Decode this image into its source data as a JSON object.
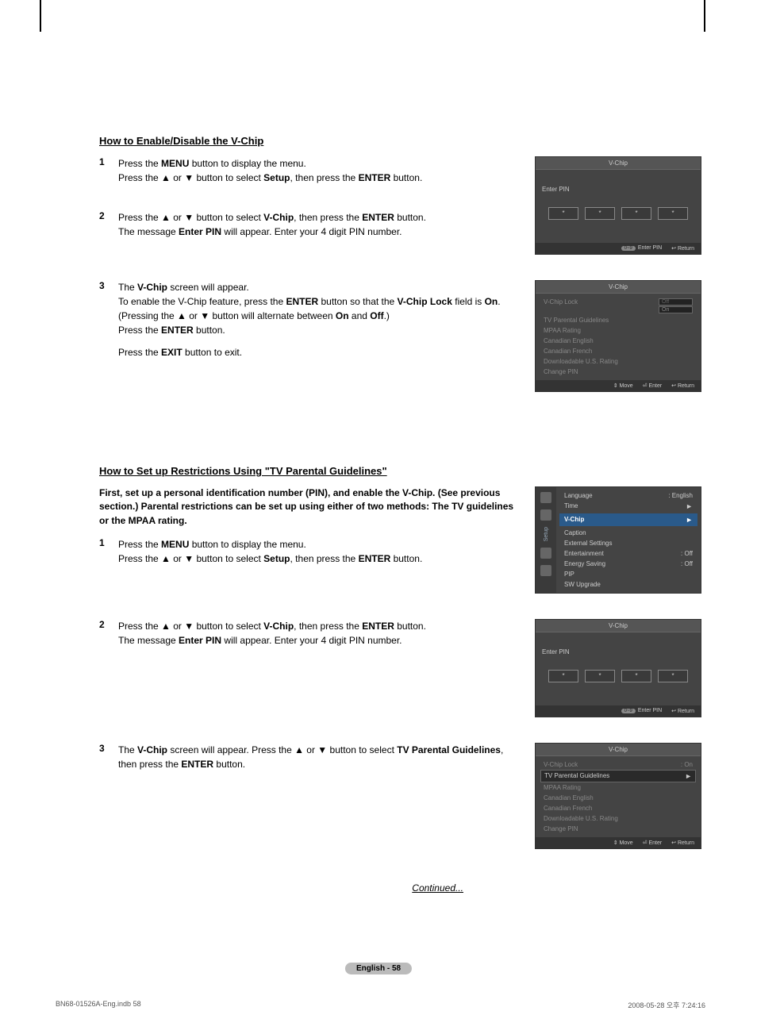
{
  "section1_title": "How to Enable/Disable the V-Chip",
  "section2_title": "How to Set up Restrictions Using \"TV Parental Guidelines\"",
  "intro": "First, set up a personal identification number (PIN), and enable the V-Chip. (See previous section.) Parental restrictions can be set up using either of two methods: The TV guidelines or the MPAA rating.",
  "s1": {
    "step1_a": "Press the ",
    "step1_b": "MENU",
    "step1_c": " button to display the menu.",
    "step1_d": "Press the ▲ or ▼ button to select ",
    "step1_e": "Setup",
    "step1_f": ", then press the ",
    "step1_g": "ENTER",
    "step1_h": " button.",
    "step2_a": "Press the ▲ or ▼ button to select ",
    "step2_b": "V-Chip",
    "step2_c": ", then press the ",
    "step2_d": "ENTER",
    "step2_e": " button.",
    "step2_f": "The message ",
    "step2_g": "Enter PIN",
    "step2_h": " will appear. Enter your 4 digit PIN number.",
    "step3_a": "The ",
    "step3_b": "V-Chip",
    "step3_c": " screen will appear.",
    "step3_d": "To enable the V-Chip feature, press the ",
    "step3_e": "ENTER",
    "step3_f": " button so that the ",
    "step3_g": "V-Chip Lock",
    "step3_h": " field is ",
    "step3_i": "On",
    "step3_j": ". (Pressing the ▲ or ▼ button will alternate between ",
    "step3_k": "On",
    "step3_l": " and ",
    "step3_m": "Off",
    "step3_n": ".)",
    "step3_o": "Press the ",
    "step3_p": "ENTER",
    "step3_q": " button.",
    "step3_r": "Press the ",
    "step3_s": "EXIT",
    "step3_t": " button to exit."
  },
  "s2": {
    "step3_a": "The ",
    "step3_b": "V-Chip",
    "step3_c": " screen will appear. Press the ▲ or ▼ button to select ",
    "step3_d": "TV Parental Guidelines",
    "step3_e": ", then press the ",
    "step3_f": "ENTER",
    "step3_g": " button."
  },
  "tv": {
    "vchip": "V-Chip",
    "enter_pin": "Enter PIN",
    "star": "*",
    "foot_09": "0~9",
    "foot_enterpin": "Enter PIN",
    "foot_return": "Return",
    "foot_move": "Move",
    "foot_enter": "Enter",
    "lock": "V-Chip Lock",
    "tvpg": "TV Parental Guidelines",
    "mpaa": "MPAA Rating",
    "ce": "Canadian English",
    "cf": "Canadian French",
    "dus": "Downloadable U.S. Rating",
    "cpin": "Change PIN",
    "off": "Off",
    "on": "On",
    "onval": ": On",
    "lang": "Language",
    "lang_v": ": English",
    "time": "Time",
    "vchip_m": "V-Chip",
    "caption": "Caption",
    "ext": "External Settings",
    "ent": "Entertainment",
    "ent_v": ": Off",
    "es": "Energy Saving",
    "es_v": ": Off",
    "pip": "PIP",
    "sw": "SW Upgrade",
    "setup": "Setup",
    "tri": "►"
  },
  "continued": "Continued...",
  "badge": "English - 58",
  "footer_left": "BN68-01526A-Eng.indb   58",
  "footer_right": "2008-05-28   오후 7:24:16"
}
